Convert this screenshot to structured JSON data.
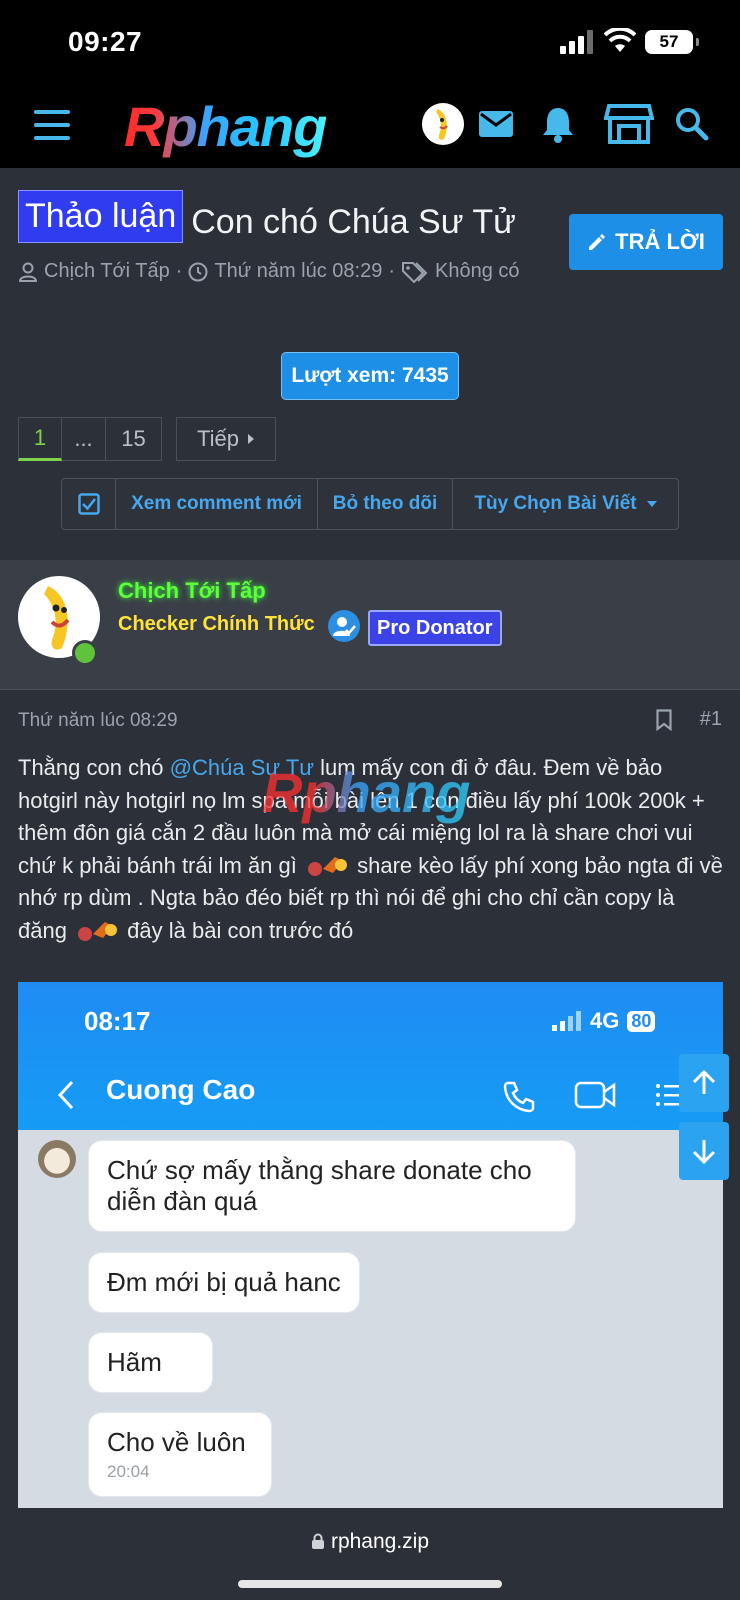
{
  "status_bar": {
    "time": "09:27",
    "battery": "57"
  },
  "header": {
    "logo": "Rphang"
  },
  "thread": {
    "prefix": "Thảo luận",
    "title": "Con chó Chúa Sư Tử",
    "reply_label": "TRẢ LỜI",
    "author": "Chịch Tới Tấp",
    "date": "Thứ năm lúc 08:29",
    "tags": "Không có",
    "views": "Lượt xem: 7435",
    "pages": {
      "current": "1",
      "ellipsis": "...",
      "last": "15",
      "next": "Tiếp"
    },
    "actions": [
      "Xem comment mới",
      "Bỏ theo dõi",
      "Tùy Chọn Bài Viết"
    ]
  },
  "user": {
    "name": "Chịch Tới Tấp",
    "title": "Checker Chính Thức",
    "badge": "Pro Donator"
  },
  "post": {
    "date": "Thứ năm lúc 08:29",
    "number": "#1",
    "mention": "@Chúa Sư Tư",
    "text_before": "Thằng con chó ",
    "text_1": " lum mấy con đi ở đâu. Đem về bảo hotgirl này hotgirl nọ lm spa mỗi bài lên 1 con điều lấy phí 100k 200k + thêm đôn giá cắn 2 đầu luôn mà mở cái miệng lol ra là share chơi vui chứ k phải bánh trái lm ăn gì ",
    "text_2": " share kèo lấy phí xong bảo ngta đi về nhớ rp dùm . Ngta bảo đéo biết rp thì nói để ghi cho chỉ cần copy là đăng ",
    "text_3": " đây là bài con trước đó",
    "watermark": "Rphang"
  },
  "embedded": {
    "time": "08:17",
    "network": "4G",
    "battery": "80",
    "contact": "Cuong Cao",
    "messages": [
      {
        "text": "Chứ sợ mấy thằng share donate cho diễn đàn quá"
      },
      {
        "text": "Đm mới bị quả hanc"
      },
      {
        "text": "Hãm"
      },
      {
        "text": "Cho về luôn",
        "time": "20:04"
      }
    ]
  },
  "browser": {
    "url": "rphang.zip"
  },
  "colors": {
    "accent": "#1e8fe6",
    "link": "#47a7ee",
    "username": "#5dff3a",
    "user_title": "#ffe23a",
    "prefix": "#2f3cf0"
  }
}
